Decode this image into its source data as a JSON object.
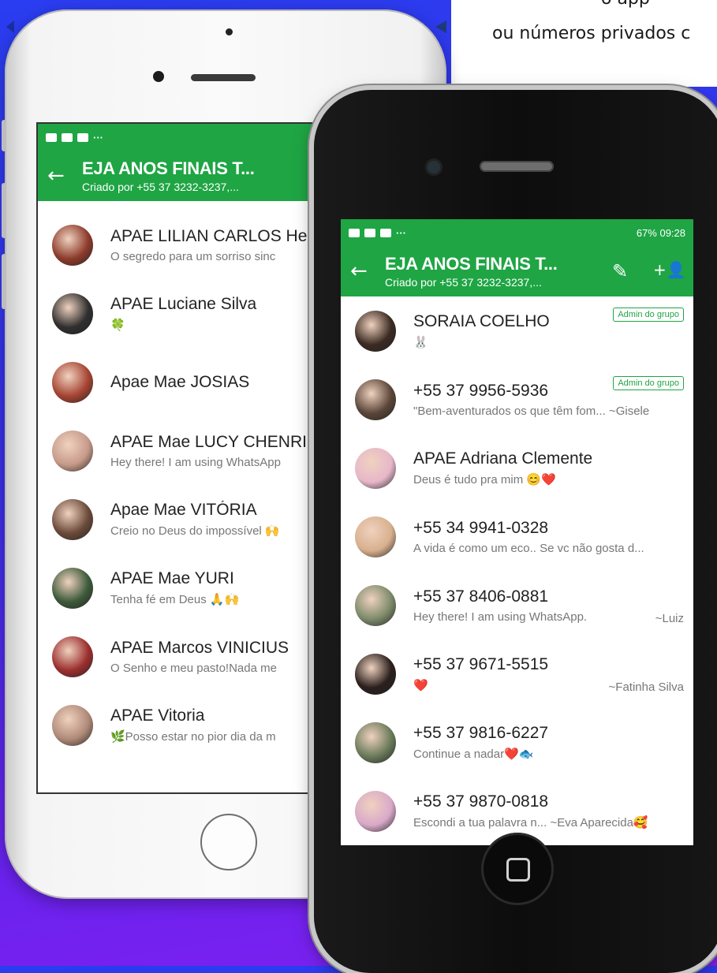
{
  "background_caption": {
    "line1": "o app",
    "line2": "ou números privados c"
  },
  "colors": {
    "whatsapp_green": "#1fa544",
    "badge_text": "#1fa544"
  },
  "left_phone": {
    "status": {
      "left_icons": "···",
      "right": "◥ ≋"
    },
    "appbar": {
      "title": "EJA ANOS FINAIS T...",
      "subtitle": "Criado por +55 37 3232-3237,...",
      "back_icon": "←"
    },
    "members": [
      {
        "name": "APAE LILIAN CARLOS Her",
        "status": "O segredo para um sorriso sinc"
      },
      {
        "name": "APAE Luciane Silva",
        "status": "🍀"
      },
      {
        "name": "Apae Mae JOSIAS",
        "status": ""
      },
      {
        "name": "APAE Mae LUCY CHENRIC",
        "status": "Hey there! I am using WhatsApp"
      },
      {
        "name": "Apae Mae VITÓRIA",
        "status": "Creio no Deus do impossível 🙌"
      },
      {
        "name": "APAE Mae YURI",
        "status": "Tenha fé em Deus 🙏🙌"
      },
      {
        "name": "APAE Marcos VINICIUS",
        "status": "O Senho e meu pasto!Nada me"
      },
      {
        "name": "APAE Vitoria",
        "status": "🌿Posso estar no pior dia da m"
      }
    ]
  },
  "right_phone": {
    "status": {
      "left_icons": "···",
      "right": "67% 09:28"
    },
    "appbar": {
      "title": "EJA ANOS FINAIS T...",
      "subtitle": "Criado por +55 37 3232-3237,...",
      "back_icon": "←",
      "edit_icon": "✎",
      "add_icon": "+👤"
    },
    "members": [
      {
        "name": "SORAIA COELHO",
        "status": "🐰",
        "badge": "Admin do grupo",
        "signature": ""
      },
      {
        "name": "+55 37 9956-5936",
        "status": "\"Bem-aventurados os que têm fom... ~Gisele",
        "badge": "Admin do grupo",
        "signature": ""
      },
      {
        "name": "APAE Adriana Clemente",
        "status": "Deus é tudo pra mim 😊❤️",
        "badge": "",
        "signature": ""
      },
      {
        "name": "+55 34 9941-0328",
        "status": "A vida é como um eco.. Se vc não gosta d...",
        "badge": "",
        "signature": ""
      },
      {
        "name": "+55 37 8406-0881",
        "status": "Hey there! I am using WhatsApp.",
        "badge": "",
        "signature": "~Luiz"
      },
      {
        "name": "+55 37 9671-5515",
        "status": "❤️",
        "badge": "",
        "signature": "~Fatinha Silva"
      },
      {
        "name": "+55 37 9816-6227",
        "status": "Continue a nadar❤️🐟",
        "badge": "",
        "signature": ""
      },
      {
        "name": "+55 37 9870-0818",
        "status": "Escondi a tua palavra n... ~Eva Aparecida🥰",
        "badge": "",
        "signature": ""
      }
    ]
  }
}
